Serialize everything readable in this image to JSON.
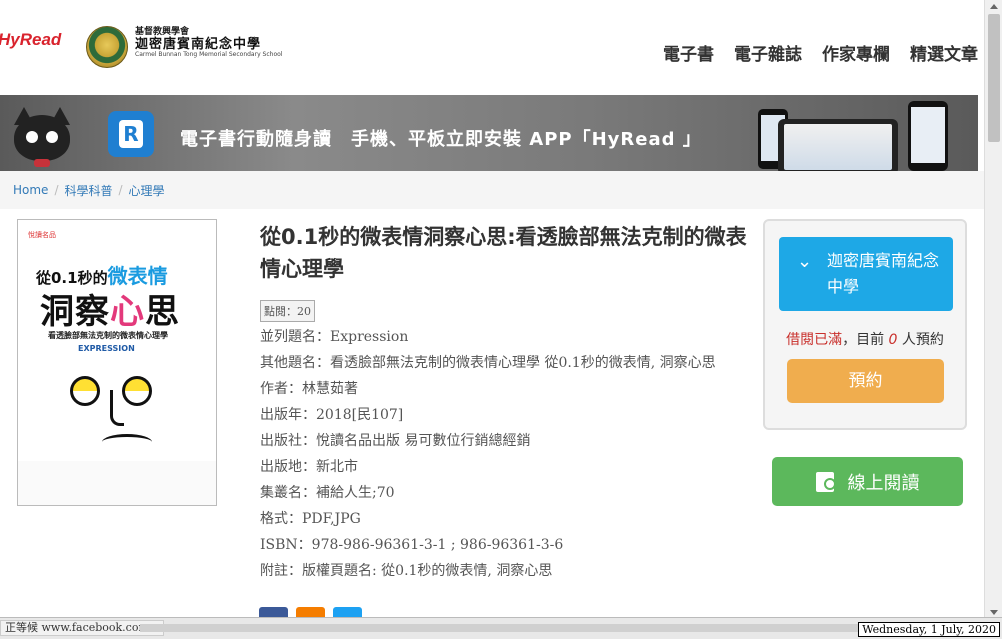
{
  "header": {
    "hyread_logo": "HyRead",
    "school_small": "基督教興學會",
    "school_name": "迦密唐賓南紀念中學",
    "school_eng": "Carmel Bunnan Tong Memorial Secondary School",
    "nav": [
      "電子書",
      "電子雜誌",
      "作家專欄",
      "精選文章"
    ]
  },
  "banner": {
    "text": "電子書行動隨身讀　手機、平板立即安裝 APP「HyRead 」",
    "app_letter": "R"
  },
  "breadcrumb": [
    "Home",
    "科學科普",
    "心理學"
  ],
  "cover": {
    "publisher_mark": "悅讀名品",
    "line1_pre": "從0.1秒的",
    "line1_hl": "微表情",
    "line2_pre": "洞察",
    "line2_pink": "心",
    "line2_post": "思",
    "line3": "看透臉部無法克制的微表情心理學",
    "line4": "EXPRESSION"
  },
  "book": {
    "title": "從0.1秒的微表情洞察心思:看透臉部無法克制的微表情心理學",
    "views": "點閱：20",
    "meta": [
      {
        "label": "並列題名：",
        "value": "Expression"
      },
      {
        "label": "其他題名：",
        "value": "看透臉部無法克制的微表情心理學 從0.1秒的微表情, 洞察心思"
      },
      {
        "label": "作者：",
        "value": "林慧茹著"
      },
      {
        "label": "出版年：",
        "value": "2018[民107]"
      },
      {
        "label": "出版社：",
        "value": "悅讀名品出版 易可數位行銷總經銷"
      },
      {
        "label": "出版地：",
        "value": "新北市"
      },
      {
        "label": "集叢名：",
        "value": "補給人生;70"
      },
      {
        "label": "格式：",
        "value": "PDF,JPG"
      },
      {
        "label": "ISBN：",
        "value": "978-986-96361-3-1 ; 986-96361-3-6"
      },
      {
        "label": "附註：",
        "value": "版權頁題名: 從0.1秒的微表情, 洞察心思"
      }
    ]
  },
  "panel": {
    "library": "迦密唐賓南紀念中學",
    "status_red": "借閱已滿",
    "status_mid": "，目前 ",
    "status_num": "0",
    "status_end": " 人預約",
    "reserve": "預約",
    "read_online": "線上閱讀"
  },
  "statusbar": {
    "url": "正等候 www.facebook.com...",
    "date": "Wednesday, 1 July, 2020"
  },
  "colors": {
    "lib_blue": "#1ea8e6",
    "reserve_orange": "#f0ad4e",
    "read_green": "#5cb85c",
    "status_red": "#c9302c",
    "link_blue": "#337ab7"
  }
}
